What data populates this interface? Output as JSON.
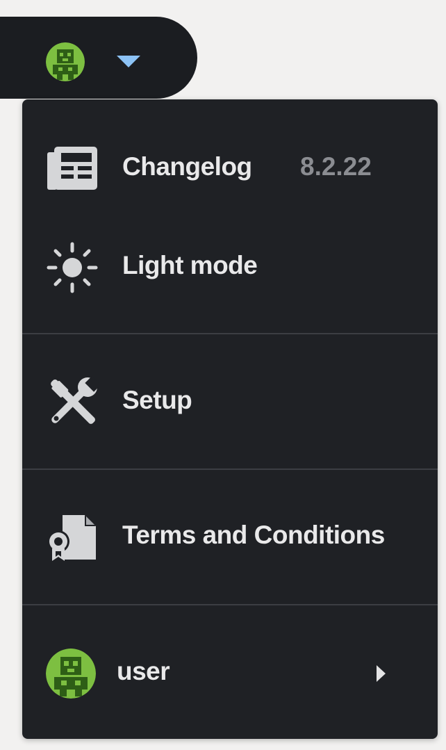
{
  "header": {
    "avatar_icon": "user-avatar-icon",
    "dropdown_icon": "caret-down-icon",
    "caret_color": "#8cc2f5"
  },
  "menu": {
    "items": [
      {
        "icon": "newspaper-icon",
        "label": "Changelog",
        "badge": "8.2.22"
      },
      {
        "icon": "sun-icon",
        "label": "Light mode"
      },
      {
        "icon": "tools-icon",
        "label": "Setup"
      },
      {
        "icon": "certificate-document-icon",
        "label": "Terms and Conditions"
      }
    ],
    "user": {
      "icon": "user-avatar-icon",
      "label": "user",
      "chevron_icon": "chevron-right-icon"
    }
  },
  "colors": {
    "menu_background": "#1f2125",
    "label_text": "#e9e9ea",
    "version_text": "#8b8d92",
    "avatar_green": "#7dbf41",
    "avatar_dark": "#2e5e16"
  }
}
